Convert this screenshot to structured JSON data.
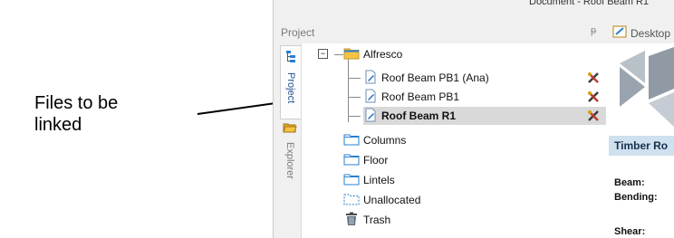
{
  "annotation": {
    "text_line1": "Files to be",
    "text_line2": "linked"
  },
  "window": {
    "title": "Document - Roof Beam R1"
  },
  "project_panel": {
    "title": "Project",
    "pin_glyph": "ᵽ"
  },
  "side_tabs": [
    {
      "label": "Project",
      "icon": "project-tree-icon"
    },
    {
      "label": "Explorer",
      "icon": "folder-open-icon"
    }
  ],
  "tree": {
    "root": {
      "label": "Alfresco",
      "expander": "−",
      "icon": "folder-icon"
    },
    "files": [
      {
        "label": "Roof Beam PB1 (Ana)",
        "icon": "beam-document-icon",
        "badge": "tools-icon"
      },
      {
        "label": "Roof Beam PB1",
        "icon": "beam-document-icon",
        "badge": "tools-icon"
      },
      {
        "label": "Roof Beam R1",
        "icon": "beam-document-icon",
        "badge": "tools-icon",
        "selected": true
      }
    ],
    "folders": [
      {
        "label": "Columns",
        "icon": "folder-outline-icon"
      },
      {
        "label": "Floor",
        "icon": "folder-outline-icon"
      },
      {
        "label": "Lintels",
        "icon": "folder-outline-icon"
      },
      {
        "label": "Unallocated",
        "icon": "folder-dashed-icon"
      },
      {
        "label": "Trash",
        "icon": "trash-icon"
      }
    ]
  },
  "document": {
    "tab_label": "Desktop",
    "section_title": "Timber Ro",
    "properties": [
      "Beam:",
      "Bending:",
      "Shear:"
    ]
  },
  "colors": {
    "folder_yellow": "#f6c343",
    "folder_blue": "#2a7fd0",
    "selection": "#d9d9d9",
    "section_bar": "#cfe0ee",
    "tools_red": "#c0392b"
  }
}
